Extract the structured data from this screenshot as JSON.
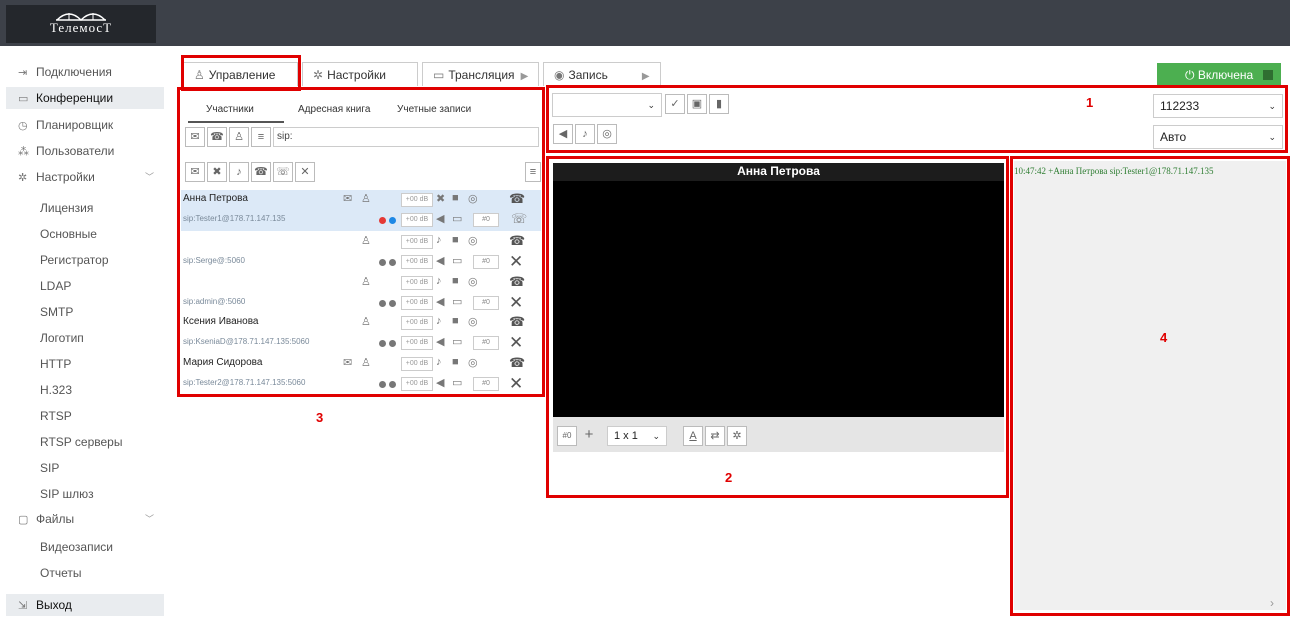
{
  "app": {
    "logo_text": "ТелемосТ"
  },
  "sidebar": {
    "items": [
      {
        "label": "Подключения",
        "icon": "connections-icon"
      },
      {
        "label": "Конференции",
        "icon": "conference-icon",
        "active": true
      },
      {
        "label": "Планировщик",
        "icon": "clock-icon"
      },
      {
        "label": "Пользователи",
        "icon": "users-icon"
      },
      {
        "label": "Настройки",
        "icon": "gear-icon"
      },
      {
        "label": "Лицензия"
      },
      {
        "label": "Основные"
      },
      {
        "label": "Регистратор"
      },
      {
        "label": "LDAP"
      },
      {
        "label": "SMTP"
      },
      {
        "label": "Логотип"
      },
      {
        "label": "HTTP"
      },
      {
        "label": "H.323"
      },
      {
        "label": "RTSP"
      },
      {
        "label": "RTSP серверы"
      },
      {
        "label": "SIP"
      },
      {
        "label": "SIP шлюз"
      },
      {
        "label": "Файлы",
        "icon": "folder-icon"
      },
      {
        "label": "Видеозаписи"
      },
      {
        "label": "Отчеты"
      },
      {
        "label": "Выход",
        "icon": "logout-icon"
      }
    ]
  },
  "tabs": {
    "control": "Управление",
    "settings": "Настройки",
    "broadcast": "Трансляция",
    "record": "Запись",
    "power": "Включена"
  },
  "participants_panel": {
    "subtabs": [
      "Участники",
      "Адресная книга",
      "Учетные записи"
    ],
    "dial_input": "sip:",
    "rows": [
      {
        "name": "Анна Петрова",
        "uri": "sip:Tester1@178.71.147.135",
        "db": "+00 dB",
        "num": "#0"
      },
      {
        "name": "",
        "uri": "sip:Serge@:5060",
        "db": "+00 dB",
        "num": "#0"
      },
      {
        "name": "",
        "uri": "sip:admin@:5060",
        "db": "+00 dB",
        "num": "#0"
      },
      {
        "name": "Ксения Иванова",
        "uri": "sip:KseniaD@178.71.147.135:5060",
        "db": "+00 dB",
        "num": "#0"
      },
      {
        "name": "Мария Сидорова",
        "uri": "sip:Tester2@178.71.147.135:5060",
        "db": "+00 dB",
        "num": "#0"
      }
    ]
  },
  "conference_bar": {
    "conference_id": "112233",
    "mode": "Авто"
  },
  "video": {
    "speaker_name": "Анна  Петрова",
    "slot": "#0",
    "layout": "1 x 1"
  },
  "log": {
    "line": "10:47:42 +Анна Петрова sip:Tester1@178.71.147.135"
  },
  "annotations": {
    "one": "1",
    "two": "2",
    "three": "3",
    "four": "4"
  },
  "colors": {
    "topbar": "#3d4149",
    "power": "#4caf50",
    "highlight": "#e00000",
    "log_text": "#2e7d32"
  }
}
